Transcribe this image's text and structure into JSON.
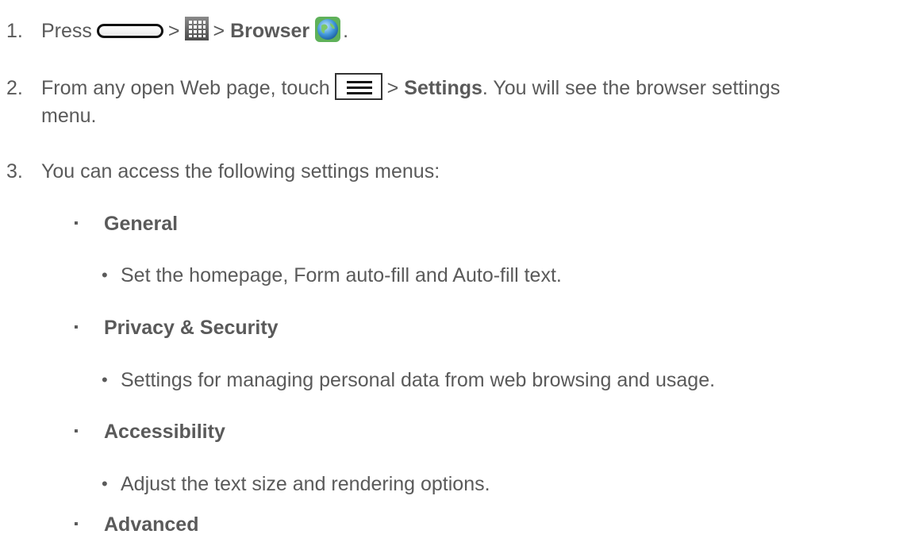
{
  "step1": {
    "number": "1.",
    "press": "Press",
    "sep1": ">",
    "sep2": ">",
    "browser": "Browser",
    "period": ".",
    "icons": [
      "home-key-icon",
      "apps-grid-icon",
      "browser-globe-icon"
    ]
  },
  "step2": {
    "number": "2.",
    "text_before": "From any open Web page, touch",
    "sep": ">",
    "settings": "Settings",
    "text_after": ". You will see the browser settings",
    "continuation": "menu.",
    "icons": [
      "menu-key-icon"
    ]
  },
  "step3": {
    "number": "3.",
    "text": "You can access the following settings menus:"
  },
  "menus": [
    {
      "bullet": "▪",
      "label": "General",
      "dot": "•",
      "description": "Set the homepage, Form auto-fill and Auto-fill text."
    },
    {
      "bullet": "▪",
      "label": "Privacy & Security",
      "dot": "•",
      "description": "Settings for managing personal data from web browsing and usage."
    },
    {
      "bullet": "▪",
      "label": "Accessibility",
      "dot": "•",
      "description": "Adjust the text size and rendering options."
    },
    {
      "bullet": "▪",
      "label": "Advanced"
    }
  ]
}
